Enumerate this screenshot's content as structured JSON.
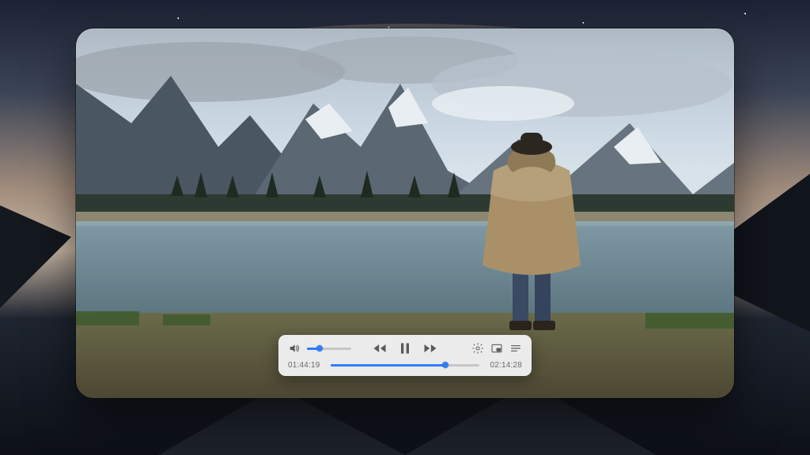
{
  "player": {
    "current_time": "01:44:19",
    "total_time": "02:14:28",
    "progress_percent": 77,
    "volume_percent": 28,
    "is_playing": true,
    "accent_color": "#2f7df6"
  }
}
